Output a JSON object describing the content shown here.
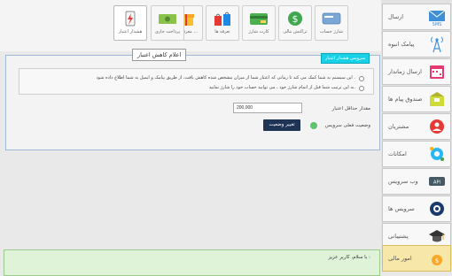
{
  "toolbar": {
    "buttons": [
      {
        "label": "شارژ حساب",
        "icon": "recharge-card-icon"
      },
      {
        "label": "تراکنش مالی",
        "icon": "money-icon"
      },
      {
        "label": "کارت شارژ",
        "icon": "card-icon"
      },
      {
        "label": "تعرفه ها",
        "icon": "tariff-bags-icon"
      },
      {
        "label": "معرفی به ...",
        "icon": "gift-icon"
      },
      {
        "label": "پرداخت جاری",
        "icon": "cash-icon"
      },
      {
        "label": "هشدار اعتبار",
        "icon": "credit-alert-icon"
      }
    ]
  },
  "sidebar": {
    "items": [
      {
        "label": "ارسال",
        "icon": "sms-icon"
      },
      {
        "label": "پیامک انبوه",
        "icon": "tower-icon"
      },
      {
        "label": "ارسال زماندار",
        "icon": "calendar-icon"
      },
      {
        "label": "صندوق پیام ها",
        "icon": "inbox-icon"
      },
      {
        "label": "مشتریان",
        "icon": "customers-icon"
      },
      {
        "label": "امکانات",
        "icon": "gear-icon"
      },
      {
        "label": "وب سرویس",
        "icon": "api-icon"
      },
      {
        "label": "سرویس ها",
        "icon": "services-icon"
      },
      {
        "label": "پشتیبانی",
        "icon": "graduation-icon"
      },
      {
        "label": "امور مالی",
        "icon": "finance-icon"
      }
    ]
  },
  "panel": {
    "title": "اعلام کاهش اعتبار",
    "tab": "سرویس هشدار اعتبار",
    "notes": [
      "این سیستم به شما کمک می کند تا زمانی که اعتبار شما از میزان مشخص شده کاهش یافت، از طریق پیامک و ایمیل به شما اطلاع داده شود .",
      "به این ترتیب شما قبل از اتمام شارژ خود ، می توانید حساب خود را شارژ نمایید."
    ],
    "min_credit_label": "مقدار حداقل اعتبار",
    "min_credit_value": "200,000",
    "change_button": "تغییر وضعیت",
    "service_status_label": "وضعیت فعلی سرویس"
  },
  "bottom": {
    "greeting": "با سلام، کاربر عزیز :"
  },
  "colors": {
    "tab": "#19d0e6",
    "button": "#1f3354",
    "active_sidebar": "#f7e7a8",
    "bottom_bg": "#dff3d8"
  }
}
